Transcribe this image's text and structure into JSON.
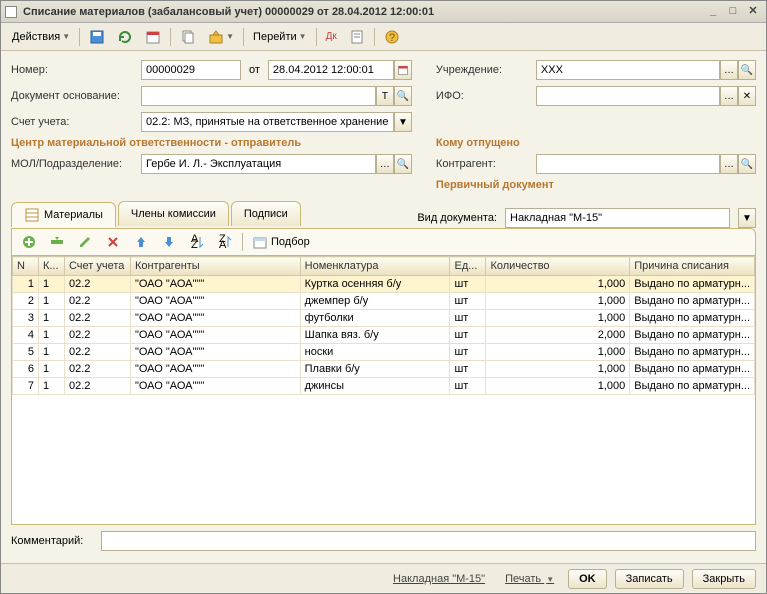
{
  "window": {
    "title": "Списание материалов (забалансовый учет) 00000029 от 28.04.2012 12:00:01"
  },
  "toolbar": {
    "actions": "Действия",
    "goto": "Перейти"
  },
  "form": {
    "number_lbl": "Номер:",
    "number": "00000029",
    "from_lbl": "от",
    "date": "28.04.2012 12:00:01",
    "doc_base_lbl": "Документ основание:",
    "doc_base": "",
    "account_lbl": "Счет учета:",
    "account": "02.2: МЗ, принятые на ответственное хранение",
    "center_hdr": "Центр материальной ответственности - отправитель",
    "mol_lbl": "МОЛ/Подразделение:",
    "mol": "Гербе И. Л.- Эксплуатация",
    "inst_lbl": "Учреждение:",
    "inst": "ХХХ",
    "ifo_lbl": "ИФО:",
    "ifo": "",
    "whom_hdr": "Кому отпущено",
    "kagent_lbl": "Контрагент:",
    "kagent": "",
    "prim_hdr": "Первичный документ",
    "kind_lbl": "Вид документа:",
    "kind": "Накладная \"М-15\""
  },
  "tabs": {
    "materials": "Материалы",
    "commission": "Члены комиссии",
    "signs": "Подписи"
  },
  "grid_toolbar": {
    "select": "Подбор"
  },
  "columns": {
    "n": "N",
    "k": "К...",
    "acc": "Счет учета",
    "kagent": "Контрагенты",
    "nom": "Номенклатура",
    "unit": "Ед...",
    "qty": "Количество",
    "reason": "Причина списания"
  },
  "rows": [
    {
      "n": "1",
      "k": "1",
      "acc": "02.2",
      "kagent": "\"ОАО \"АОА\"\"\"",
      "nom": "Куртка осенняя б/у",
      "unit": "шт",
      "qty": "1,000",
      "reason": "Выдано по арматурн..."
    },
    {
      "n": "2",
      "k": "1",
      "acc": "02.2",
      "kagent": "\"ОАО \"АОА\"\"\"",
      "nom": "джемпер б/у",
      "unit": "шт",
      "qty": "1,000",
      "reason": "Выдано по арматурн..."
    },
    {
      "n": "3",
      "k": "1",
      "acc": "02.2",
      "kagent": "\"ОАО \"АОА\"\"\"",
      "nom": "футболки",
      "unit": "шт",
      "qty": "1,000",
      "reason": "Выдано по арматурн..."
    },
    {
      "n": "4",
      "k": "1",
      "acc": "02.2",
      "kagent": "\"ОАО \"АОА\"\"\"",
      "nom": "Шапка вяз. б/у",
      "unit": "шт",
      "qty": "2,000",
      "reason": "Выдано по арматурн..."
    },
    {
      "n": "5",
      "k": "1",
      "acc": "02.2",
      "kagent": "\"ОАО \"АОА\"\"\"",
      "nom": "носки",
      "unit": "шт",
      "qty": "1,000",
      "reason": "Выдано по арматурн..."
    },
    {
      "n": "6",
      "k": "1",
      "acc": "02.2",
      "kagent": "\"ОАО \"АОА\"\"\"",
      "nom": "Плавки б/у",
      "unit": "шт",
      "qty": "1,000",
      "reason": "Выдано по арматурн..."
    },
    {
      "n": "7",
      "k": "1",
      "acc": "02.2",
      "kagent": "\"ОАО \"АОА\"\"\"",
      "nom": "джинсы",
      "unit": "шт",
      "qty": "1,000",
      "reason": "Выдано по арматурн..."
    }
  ],
  "comment_lbl": "Комментарий:",
  "comment": "",
  "status": {
    "invoice": "Накладная \"М-15\"",
    "print": "Печать",
    "ok": "OK",
    "save": "Записать",
    "close": "Закрыть"
  }
}
